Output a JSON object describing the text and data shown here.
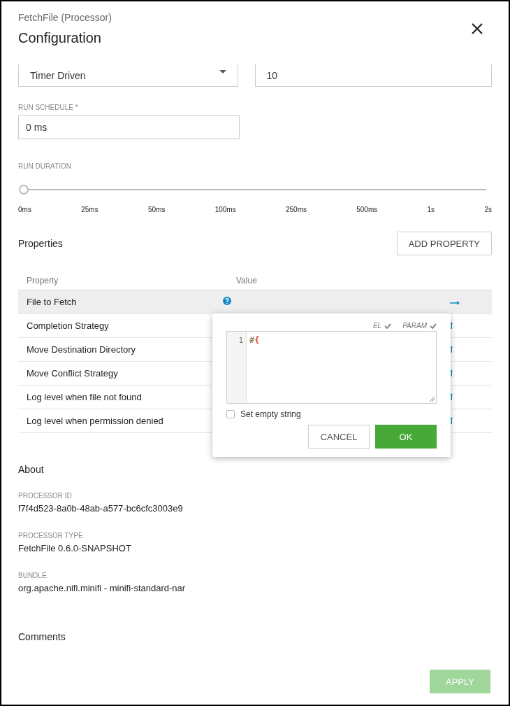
{
  "header": {
    "subtitle": "FetchFile (Processor)",
    "title": "Configuration"
  },
  "scheduling": {
    "strategy": {
      "value": "Timer Driven"
    },
    "concurrent_tasks": {
      "value": "10"
    }
  },
  "run_schedule": {
    "label": "RUN SCHEDULE *",
    "value": "0 ms"
  },
  "run_duration": {
    "label": "RUN DURATION",
    "level": 0,
    "ticks": [
      "0ms",
      "25ms",
      "50ms",
      "100ms",
      "250ms",
      "500ms",
      "1s",
      "2s"
    ]
  },
  "properties": {
    "title": "Properties",
    "add_button": "ADD PROPERTY",
    "columns": [
      "Property",
      "Value"
    ],
    "rows": [
      {
        "name": "File to Fetch",
        "selected": true,
        "has_help": true
      },
      {
        "name": "Completion Strategy",
        "selected": false,
        "has_help": false
      },
      {
        "name": "Move Destination Directory",
        "selected": false,
        "has_help": false
      },
      {
        "name": "Move Conflict Strategy",
        "selected": false,
        "has_help": false
      },
      {
        "name": "Log level when file not found",
        "selected": false,
        "has_help": false
      },
      {
        "name": "Log level when permission denied",
        "selected": false,
        "has_help": false
      }
    ]
  },
  "editor_popup": {
    "flags": [
      "EL",
      "PARAM"
    ],
    "line_number": "1",
    "code_tokens": [
      {
        "text": "#",
        "color": "#8c8a5e"
      },
      {
        "text": "{",
        "color": "#e53935"
      }
    ],
    "empty_string": {
      "label": "Set empty string",
      "checked": false
    },
    "cancel": "CANCEL",
    "ok": "OK"
  },
  "about": {
    "title": "About",
    "fields": [
      {
        "label": "PROCESSOR ID",
        "value": "f7f4d523-8a0b-48ab-a577-bc6cfc3003e9"
      },
      {
        "label": "PROCESSOR TYPE",
        "value": "FetchFile 0.6.0-SNAPSHOT"
      },
      {
        "label": "BUNDLE",
        "value": "org.apache.nifi.minifi - minifi-standard-nar"
      }
    ]
  },
  "comments": {
    "title": "Comments"
  },
  "apply": {
    "label": "APPLY",
    "disabled": true
  }
}
